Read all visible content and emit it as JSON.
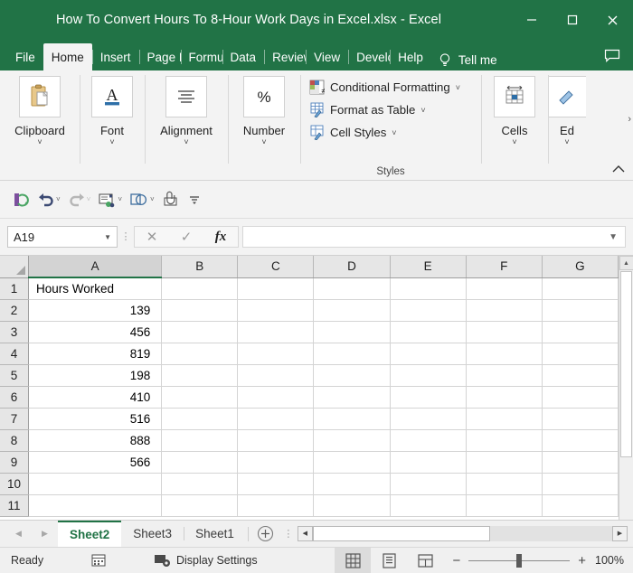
{
  "window": {
    "title": "How To Convert Hours To 8-Hour Work Days in Excel.xlsx  -  Excel",
    "minimize_label": "Minimize",
    "maximize_label": "Maximize",
    "close_label": "Close",
    "brand_color": "#217346"
  },
  "ribbon": {
    "tabs": [
      {
        "label": "File",
        "active": false
      },
      {
        "label": "Home",
        "active": true
      },
      {
        "label": "Insert",
        "active": false
      },
      {
        "label": "Page Lã",
        "active": false
      },
      {
        "label": "Formul",
        "active": false
      },
      {
        "label": "Data",
        "active": false
      },
      {
        "label": "Review",
        "active": false
      },
      {
        "label": "View",
        "active": false
      },
      {
        "label": "Develc",
        "active": false
      },
      {
        "label": "Help",
        "active": false
      }
    ],
    "tell_me": "Tell me",
    "groups": [
      {
        "label": "Clipboard",
        "icon": "clipboard-icon"
      },
      {
        "label": "Font",
        "icon": "font-icon"
      },
      {
        "label": "Alignment",
        "icon": "alignment-icon"
      },
      {
        "label": "Number",
        "icon": "percent-icon"
      }
    ],
    "styles": {
      "caption": "Styles",
      "items": [
        {
          "label": "Conditional Formatting",
          "icon": "conditional-formatting-icon"
        },
        {
          "label": "Format as Table",
          "icon": "format-as-table-icon"
        },
        {
          "label": "Cell Styles",
          "icon": "cell-styles-icon"
        }
      ]
    },
    "cells_group": {
      "label": "Cells",
      "icon": "cells-icon"
    },
    "editing_group": {
      "label": "Ed",
      "icon": "editing-icon"
    },
    "overflow_arrow": "›",
    "collapse_arrow": "⌃"
  },
  "quick_access": {
    "items": [
      {
        "name": "autosave-sync-icon",
        "has_chevron": false,
        "disabled": false
      },
      {
        "name": "undo-icon",
        "has_chevron": true,
        "disabled": false
      },
      {
        "name": "redo-icon",
        "has_chevron": true,
        "disabled": true
      },
      {
        "name": "email-icon",
        "has_chevron": true,
        "disabled": false
      },
      {
        "name": "shapes-icon",
        "has_chevron": true,
        "disabled": false
      },
      {
        "name": "attach-icon",
        "has_chevron": false,
        "disabled": false
      },
      {
        "name": "customize-toolbar-icon",
        "has_chevron": false,
        "disabled": false
      }
    ]
  },
  "formula_bar": {
    "name_box_value": "A19",
    "cancel_label": "✕",
    "enter_label": "✓",
    "function_label": "fx",
    "formula_value": "",
    "formula_placeholder": ""
  },
  "grid": {
    "columns": [
      "A",
      "B",
      "C",
      "D",
      "E",
      "F",
      "G"
    ],
    "selected_column": "A",
    "rows": [
      {
        "n": "1",
        "A": "Hours Worked",
        "align": "txt"
      },
      {
        "n": "2",
        "A": "139",
        "align": "num"
      },
      {
        "n": "3",
        "A": "456",
        "align": "num"
      },
      {
        "n": "4",
        "A": "819",
        "align": "num"
      },
      {
        "n": "5",
        "A": "198",
        "align": "num"
      },
      {
        "n": "6",
        "A": "410",
        "align": "num"
      },
      {
        "n": "7",
        "A": "516",
        "align": "num"
      },
      {
        "n": "8",
        "A": "888",
        "align": "num"
      },
      {
        "n": "9",
        "A": "566",
        "align": "num"
      },
      {
        "n": "10",
        "A": "",
        "align": "num"
      },
      {
        "n": "11",
        "A": "",
        "align": "num"
      }
    ]
  },
  "sheet_tabs": {
    "prev_label": "◀",
    "next_label": "▶",
    "tabs": [
      {
        "label": "Sheet2",
        "active": true
      },
      {
        "label": "Sheet3",
        "active": false
      },
      {
        "label": "Sheet1",
        "active": false
      }
    ],
    "add_sheet_label": "+"
  },
  "status_bar": {
    "state": "Ready",
    "display_settings": "Display Settings",
    "views": [
      {
        "name": "normal-view",
        "active": true
      },
      {
        "name": "page-layout-view",
        "active": false
      },
      {
        "name": "page-break-preview",
        "active": false
      }
    ],
    "zoom_out_label": "−",
    "zoom_in_label": "+",
    "zoom_level": "100%"
  }
}
